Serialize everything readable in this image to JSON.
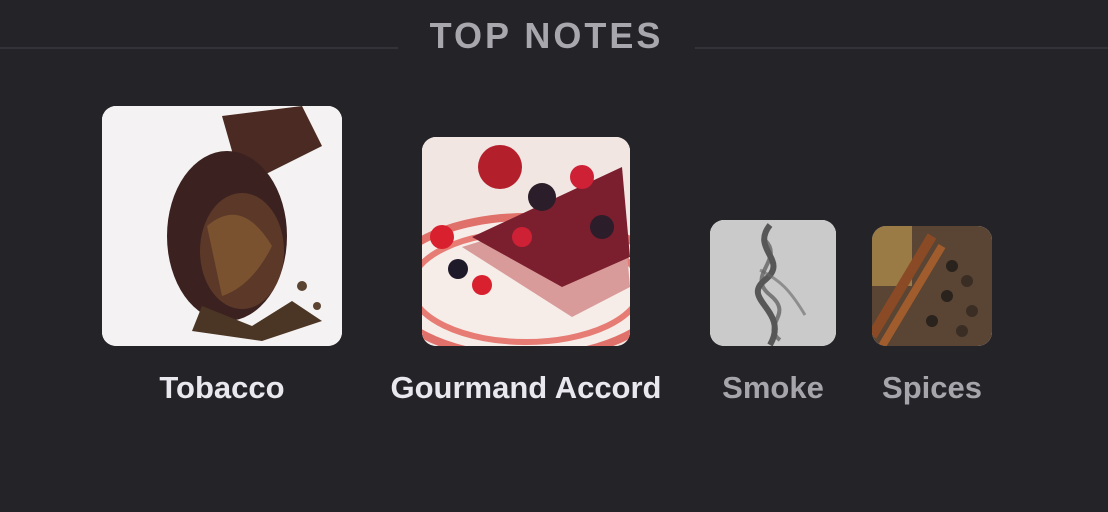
{
  "section": {
    "title": "TOP NOTES"
  },
  "notes": [
    {
      "label": "Tobacco",
      "image_icon": "tobacco-pipe-image",
      "emphasis": "primary"
    },
    {
      "label": "Gourmand Accord",
      "image_icon": "berry-cake-image",
      "emphasis": "primary"
    },
    {
      "label": "Smoke",
      "image_icon": "smoke-image",
      "emphasis": "secondary"
    },
    {
      "label": "Spices",
      "image_icon": "spices-image",
      "emphasis": "secondary"
    }
  ],
  "colors": {
    "background": "#242328",
    "divider": "#34333a",
    "title": "#a8a7ad",
    "label_primary": "#e9e8ee",
    "label_secondary": "#a6a5ab"
  }
}
